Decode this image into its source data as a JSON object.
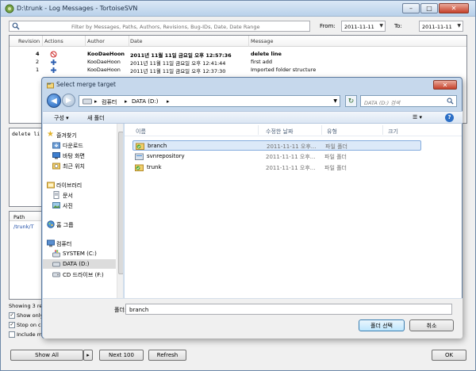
{
  "main": {
    "title": "D:\\trunk - Log Messages - TortoiseSVN",
    "filter_placeholder": "Filter by Messages, Paths, Authors, Revisions, Bug-IDs, Date, Date Range",
    "from_label": "From:",
    "from_date": "2011-11-11",
    "to_label": "To:",
    "to_date": "2011-11-11",
    "columns": [
      "Revision",
      "Actions",
      "Author",
      "Date",
      "Message"
    ],
    "rows": [
      {
        "revision": "4",
        "author": "KooDaeHoon",
        "date": "2011년 11월 11일 금요일 오후 12:57:36",
        "message": "delete line"
      },
      {
        "revision": "2",
        "author": "KooDaeHoon",
        "date": "2011년 11월 11일 금요일 오후 12:41:44",
        "message": "first add"
      },
      {
        "revision": "1",
        "author": "KooDaeHoon",
        "date": "2011년 11월 11일 금요일 오후 12:37:30",
        "message": "Imported folder structure"
      }
    ],
    "message_text": "delete li",
    "path_header": "Path",
    "path_row": "/trunk/T",
    "showing_text": "Showing 3 re",
    "checkbox_1": "Show only",
    "checkbox_2": "Stop on c",
    "checkbox_3": "Include m",
    "show_all_label": "Show All",
    "next_label": "Next 100",
    "refresh_label": "Refresh",
    "ok_label": "OK"
  },
  "dialog": {
    "title": "Select merge target",
    "address_segments": [
      "컴퓨터",
      "DATA (D:)"
    ],
    "search_placeholder": "DATA (D:) 검색",
    "organize_label": "구성",
    "new_folder_label": "새 폴더",
    "nav_favorites": "즐겨찾기",
    "nav_downloads": "다운로드",
    "nav_desktop": "바탕 화면",
    "nav_recent": "최근 위치",
    "nav_libraries": "라이브러리",
    "nav_documents": "문서",
    "nav_pictures": "사진",
    "nav_homegroup": "홈 그룹",
    "nav_computer": "컴퓨터",
    "nav_system": "SYSTEM (C:)",
    "nav_data": "DATA (D:)",
    "nav_cd": "CD 드라이브 (F:)",
    "col_name": "이름",
    "col_modified": "수정한 날짜",
    "col_type": "유형",
    "col_size": "크기",
    "files": [
      {
        "name": "branch",
        "modified": "2011-11-11 오후...",
        "type": "파일 폴더"
      },
      {
        "name": "svnrepository",
        "modified": "2011-11-11 오후...",
        "type": "파일 폴더"
      },
      {
        "name": "trunk",
        "modified": "2011-11-11 오후...",
        "type": "파일 폴더"
      }
    ],
    "folder_label": "폴더:",
    "folder_value": "branch",
    "select_label": "폴더 선택",
    "cancel_label": "취소"
  }
}
